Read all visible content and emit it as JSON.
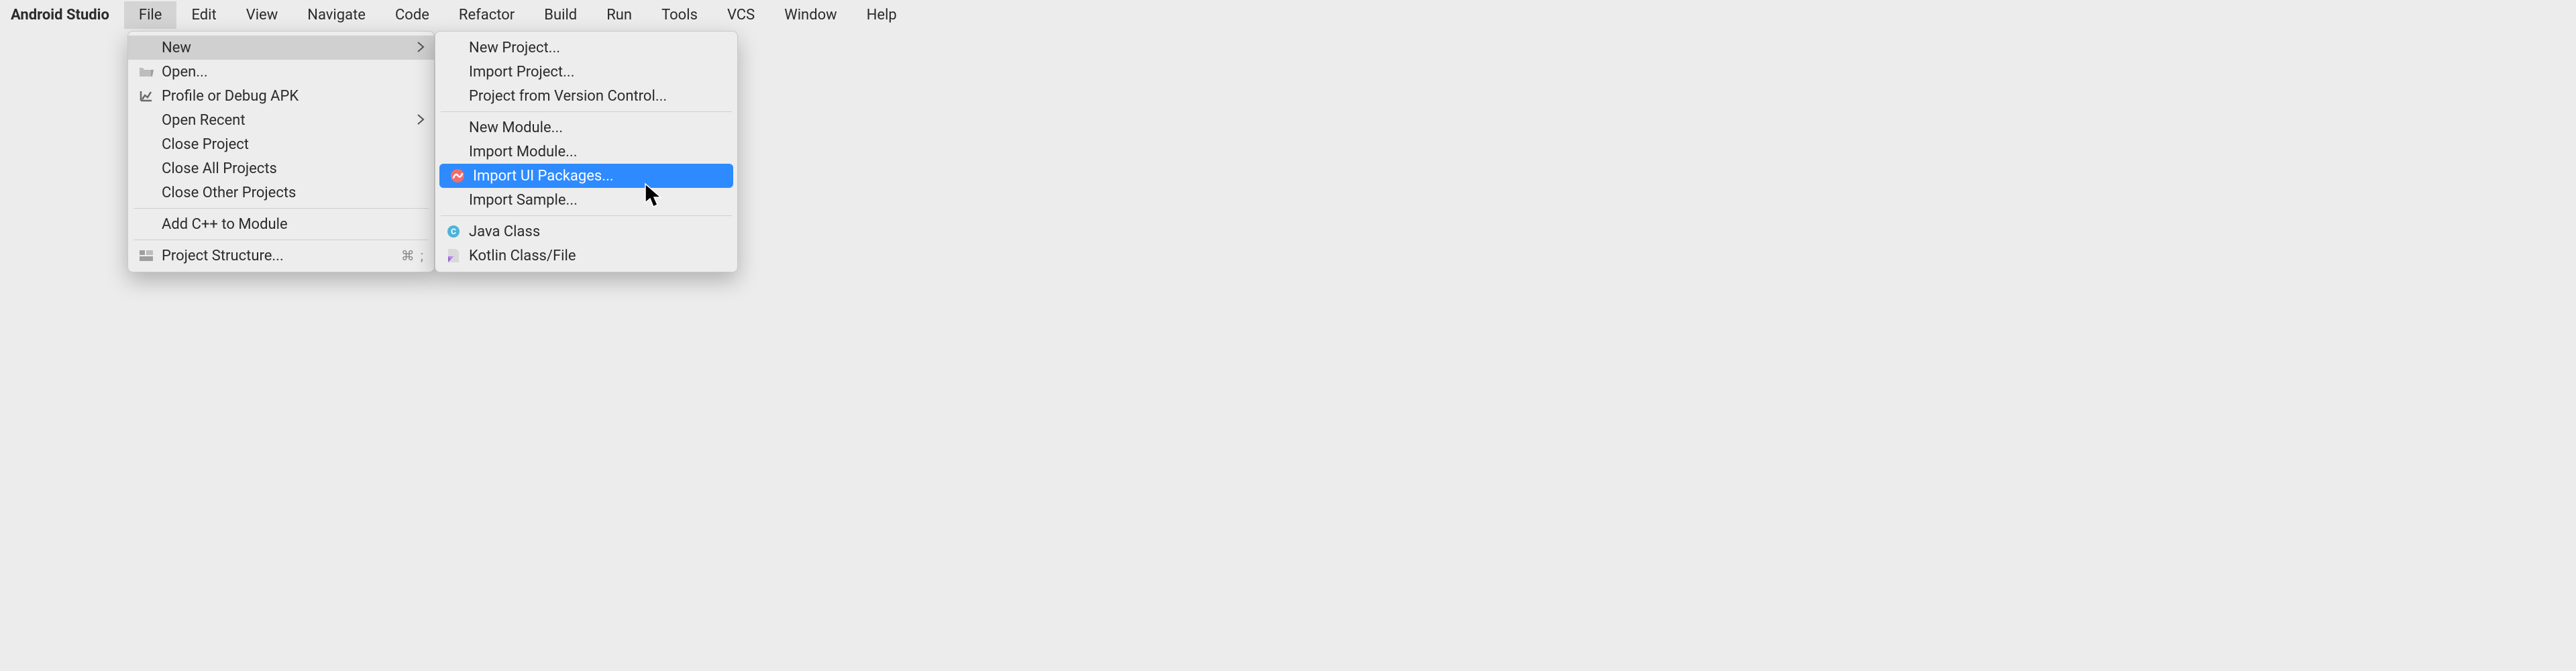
{
  "menubar": {
    "app_title": "Android Studio",
    "items": [
      "File",
      "Edit",
      "View",
      "Navigate",
      "Code",
      "Refactor",
      "Build",
      "Run",
      "Tools",
      "VCS",
      "Window",
      "Help"
    ],
    "active_index": 0
  },
  "file_menu": {
    "new": "New",
    "open": "Open...",
    "profile_debug": "Profile or Debug APK",
    "open_recent": "Open Recent",
    "close_project": "Close Project",
    "close_all": "Close All Projects",
    "close_other": "Close Other Projects",
    "add_cpp": "Add C++ to Module",
    "project_structure": "Project Structure...",
    "project_structure_shortcut": "⌘ ;"
  },
  "new_submenu": {
    "new_project": "New Project...",
    "import_project": "Import Project...",
    "from_vcs": "Project from Version Control...",
    "new_module": "New Module...",
    "import_module": "Import Module...",
    "import_ui_packages": "Import UI Packages...",
    "import_sample": "Import Sample...",
    "java_class": "Java Class",
    "kotlin_class": "Kotlin Class/File"
  }
}
